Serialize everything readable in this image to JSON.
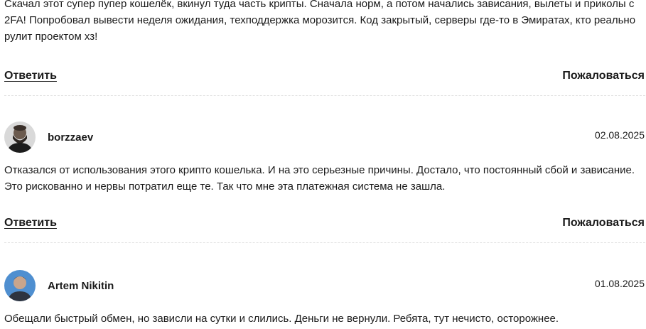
{
  "comments": [
    {
      "text": "Скачал этот супер пупер кошелёк, вкинул туда часть крипты. Сначала норм, а потом начались зависания, вылеты и приколы с 2FA! Попробовал вывести неделя ожидания, техподдержка морозится. Код закрытый, серверы где-то в Эмиратах, кто реально рулит проектом хз!",
      "reply_label": "Ответить",
      "report_label": "Пожаловаться"
    },
    {
      "username": "borzzaev",
      "date": "02.08.2025",
      "avatar_icon": "user-avatar-bearded-man",
      "text": "Отказался от использования этого крипто кошелька. И на это серьезные причины. Достало, что постоянный сбой и зависание. Это рискованно и нервы потратил еще те. Так что мне эта платежная система не зашла.",
      "reply_label": "Ответить",
      "report_label": "Пожаловаться"
    },
    {
      "username": "Artem Nikitin",
      "date": "01.08.2025",
      "avatar_icon": "user-avatar-man-blue-background",
      "text": "Обещали быстрый обмен, но зависли на сутки и слились. Деньги не вернули. Ребята, тут нечисто, осторожнее."
    }
  ],
  "colors": {
    "text": "#1a1a1a",
    "divider": "#e2e2e2",
    "avatar2_bg": "#4f8fd0"
  }
}
